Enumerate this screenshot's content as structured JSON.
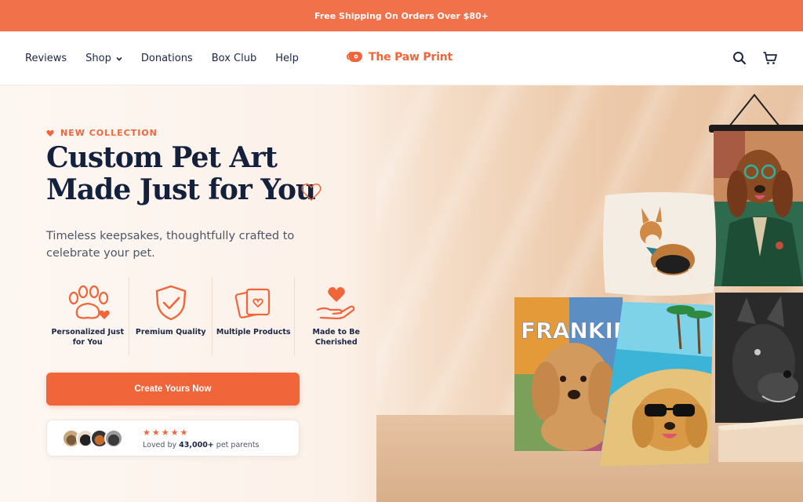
{
  "announcement": {
    "text": "Free Shipping On Orders Over $80+"
  },
  "nav": {
    "items": [
      {
        "label": "Reviews"
      },
      {
        "label": "Shop"
      },
      {
        "label": "Donations"
      },
      {
        "label": "Box Club"
      },
      {
        "label": "Help"
      }
    ]
  },
  "brand": {
    "name": "The Paw Print",
    "accent": "#f0653a"
  },
  "header_icons": [
    "search-icon",
    "cart-icon"
  ],
  "hero": {
    "eyebrow": "NEW COLLECTION",
    "title_line1": "Custom Pet Art",
    "title_line2": "Made Just for You",
    "subtitle": "Timeless keepsakes, thoughtfully crafted to celebrate your pet.",
    "features": [
      {
        "icon": "paw-heart-icon",
        "label": "Personalized Just for You"
      },
      {
        "icon": "shield-check-icon",
        "label": "Premium Quality"
      },
      {
        "icon": "stacked-frames-icon",
        "label": "Multiple Products"
      },
      {
        "icon": "heart-hand-icon",
        "label": "Made to Be Cherished"
      }
    ],
    "cta_label": "Create Yours Now",
    "rating_stars": "★★★★★",
    "social_prefix": "Loved by",
    "social_count": "43,000+",
    "social_suffix": "pet parents"
  },
  "products": {
    "blanket_name": "FRANKIE"
  },
  "colors": {
    "announce_bg": "#f0714a",
    "navy": "#14213d",
    "accent": "#f0653a"
  }
}
